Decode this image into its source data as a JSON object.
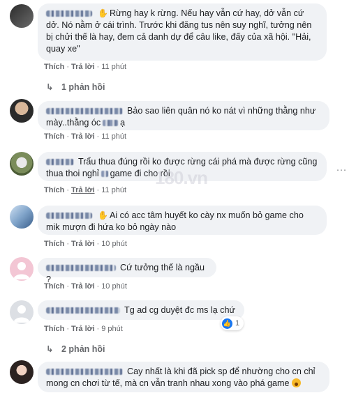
{
  "comments": [
    {
      "text": "Rừng hay k rừng. Nếu hay vẫn cứ hay, dở vẫn cứ dở. Nó nằm ở cái trình. Trước khi đăng tus nên suy nghĩ, tưởng nên bị chửi thế là hay, đem cả danh dự để câu like, đấy của xã hội. \"Hải, quay xe\"",
      "actions": {
        "like": "Thích",
        "reply": "Trả lời",
        "time": "11 phút"
      },
      "replies": "1 phản hồi"
    },
    {
      "text": "Bảo sao liên quân nó ko nát vì những thằng như mày..thằng óc",
      "text_end": "ạ",
      "actions": {
        "like": "Thích",
        "reply": "Trả lời",
        "time": "11 phút"
      }
    },
    {
      "text": "Trẩu thua đúng rồi ko được rừng cái phá mà được rừng cũng thua thoi nghỉ",
      "text_end": "game đi cho rồi",
      "actions": {
        "like": "Thích",
        "reply": "Trả lời",
        "time": "11 phút"
      }
    },
    {
      "text": "Ai có acc tâm huyết ko cày nx muốn bỏ game cho mik mượn đi hứa ko bỏ ngày nào",
      "actions": {
        "like": "Thích",
        "reply": "Trả lời",
        "time": "10 phút"
      }
    },
    {
      "text": "Cứ tưởng thế là ngầu ?",
      "actions": {
        "like": "Thích",
        "reply": "Trả lời",
        "time": "10 phút"
      }
    },
    {
      "text": "Tg ad cg duyệt đc ms lạ chứ",
      "actions": {
        "like": "Thích",
        "reply": "Trả lời",
        "time": "9 phút"
      },
      "like_count": "1",
      "replies": "2 phản hồi"
    },
    {
      "text": "Cay nhất là khi đã pick sp để nhường cho cn chỉ mong cn chơi từ tế, mà cn vẫn tranh nhau xong vào phá game"
    }
  ],
  "icons": {
    "more": "more-horizontal-icon",
    "reply_arrow": "reply-arrow-icon",
    "like": "like-thumb-icon",
    "wow": "wow-emoji-icon"
  },
  "colors": {
    "bubble": "#f0f2f5",
    "meta": "#65676b",
    "like_blue": "#1877f2"
  },
  "watermark": "180.vn"
}
